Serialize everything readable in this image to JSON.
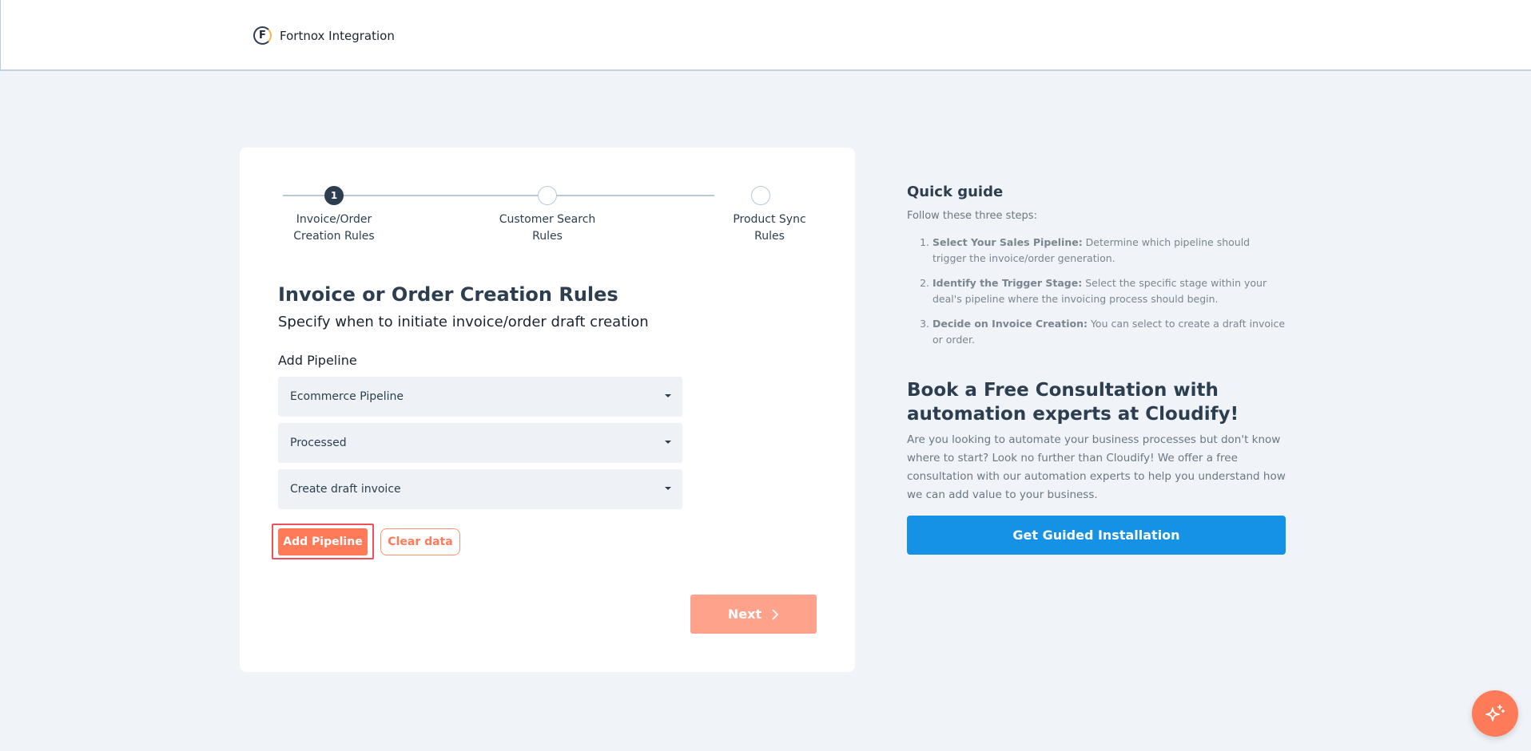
{
  "header": {
    "logo_letter": "F",
    "app_title": "Fortnox Integration"
  },
  "stepper": {
    "current_step": 1,
    "steps": [
      {
        "number": "1",
        "label": "Invoice/Order\nCreation Rules",
        "active": true
      },
      {
        "number": "",
        "label": "Customer Search\nRules",
        "active": false
      },
      {
        "number": "",
        "label": "Product Sync\nRules",
        "active": false
      }
    ]
  },
  "form": {
    "title": "Invoice or Order Creation Rules",
    "subtitle": "Specify when to initiate invoice/order draft creation",
    "pipeline_label": "Add Pipeline",
    "pipeline_select": "Ecommerce Pipeline",
    "stage_select": "Processed",
    "action_select": "Create draft invoice",
    "add_button": "Add Pipeline",
    "clear_button": "Clear data",
    "next_button": "Next"
  },
  "quick_guide": {
    "title": "Quick guide",
    "intro": "Follow these three steps:",
    "steps": [
      {
        "bold": "Select Your Sales Pipeline:",
        "text": " Determine which pipeline should trigger the invoice/order generation."
      },
      {
        "bold": "Identify the Trigger Stage:",
        "text": " Select the specific stage within your deal's pipeline where the invoicing process should begin."
      },
      {
        "bold": "Decide on Invoice Creation:",
        "text": " You can select to create a draft invoice or order."
      }
    ]
  },
  "consultation": {
    "title": "Book a Free Consultation with automation experts at Cloudify!",
    "text": "Are you looking to automate your business processes but don't know where to start? Look no further than Cloudify! We offer a free consultation with our automation experts to help you understand how we can add value to your business.",
    "button": "Get Guided Installation"
  },
  "colors": {
    "primary": "#ff7a59",
    "primary_disabled": "#ffa28b",
    "accent_blue": "#1592e6",
    "heading": "#2d3e50"
  },
  "fab": {
    "icon": "sparkles-icon"
  }
}
